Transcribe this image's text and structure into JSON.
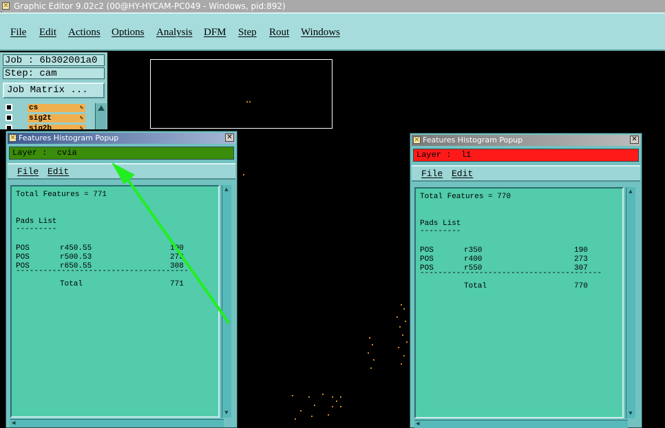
{
  "window": {
    "title": "Graphic Editor 9.02c2 (00@HY-HYCAM-PC049 - Windows, pid:892)"
  },
  "menu": {
    "items": [
      "File",
      "Edit",
      "Actions",
      "Options",
      "Analysis",
      "DFM",
      "Step",
      "Rout",
      "Windows"
    ]
  },
  "left_panel": {
    "job": "Job : 6b302001a0",
    "step": "Step: cam",
    "job_matrix_label": "Job Matrix ...",
    "layers": [
      "cs",
      "sig2t",
      "sig2b"
    ]
  },
  "popup_left": {
    "title": "Features Histogram Popup",
    "layer_label": "Layer :",
    "layer_name": "cvia",
    "layer_color": "#3a8c0a",
    "menu": {
      "file": "File",
      "edit": "Edit"
    },
    "total_line": "Total Features = 771",
    "pads_list": "Pads List",
    "rows": [
      {
        "type": "POS",
        "size": "r450.55",
        "count": "190"
      },
      {
        "type": "POS",
        "size": "r500.53",
        "count": "273"
      },
      {
        "type": "POS",
        "size": "r650.55",
        "count": "308"
      }
    ],
    "total_label": "Total",
    "total_value": "771"
  },
  "popup_right": {
    "title": "Features Histogram Popup",
    "layer_label": "Layer :",
    "layer_name": "l1",
    "layer_color": "#ff1a1a",
    "menu": {
      "file": "File",
      "edit": "Edit"
    },
    "total_line": "Total Features = 770",
    "pads_list": "Pads List",
    "rows": [
      {
        "type": "POS",
        "size": "r350",
        "count": "190"
      },
      {
        "type": "POS",
        "size": "r400",
        "count": "273"
      },
      {
        "type": "POS",
        "size": "r550",
        "count": "307"
      }
    ],
    "total_label": "Total",
    "total_value": "770"
  },
  "colors": {
    "menubar": "#a6dcdc",
    "popup_bg": "#73c2c2",
    "content_bg": "#52ccaa",
    "arrow_annotation": "#22ee22",
    "pad_dots": "#d68a2a"
  }
}
